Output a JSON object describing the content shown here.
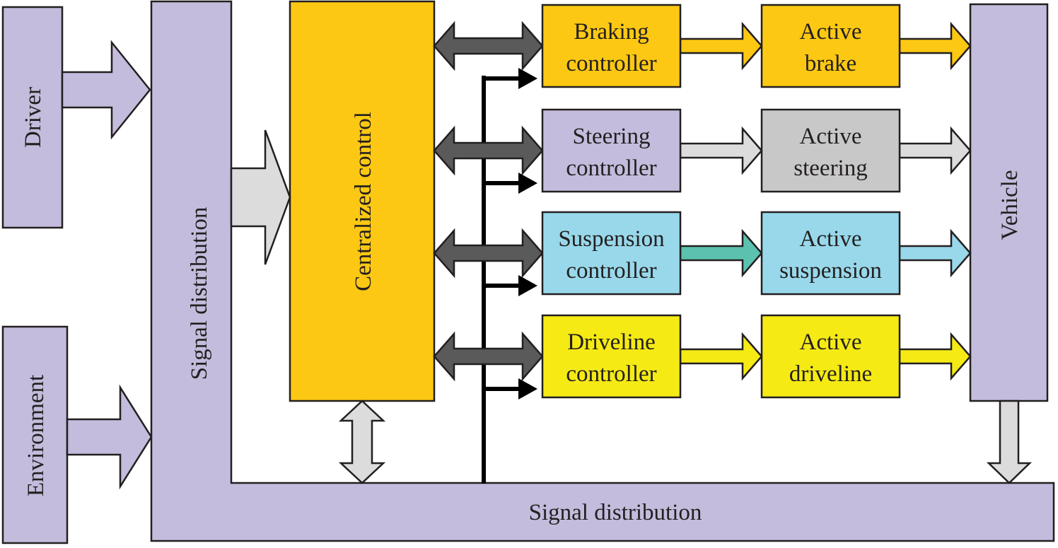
{
  "blocks": {
    "driver": "Driver",
    "environment": "Environment",
    "signal_distribution_vertical": "Signal distribution",
    "signal_distribution_horizontal": "Signal distribution",
    "centralized_control": "Centralized control",
    "vehicle": "Vehicle",
    "controllers": [
      {
        "line1": "Braking",
        "line2": "controller"
      },
      {
        "line1": "Steering",
        "line2": "controller"
      },
      {
        "line1": "Suspension",
        "line2": "controller"
      },
      {
        "line1": "Driveline",
        "line2": "controller"
      }
    ],
    "actuators": [
      {
        "line1": "Active",
        "line2": "brake"
      },
      {
        "line1": "Active",
        "line2": "steering"
      },
      {
        "line1": "Active",
        "line2": "suspension"
      },
      {
        "line1": "Active",
        "line2": "driveline"
      }
    ]
  },
  "colors": {
    "signal_purple": "#c4bcdc",
    "central_orange": "#fcc813",
    "braking": "#fcc813",
    "steering": "#c4bcdc",
    "active_steering": "#c8c8c8",
    "suspension": "#98d8ea",
    "driveline": "#f5ea14",
    "dark_arrow": "#5a5a5a",
    "light_arrow": "#dcdcdc",
    "suspension_arrow": "#5cc2b0"
  }
}
